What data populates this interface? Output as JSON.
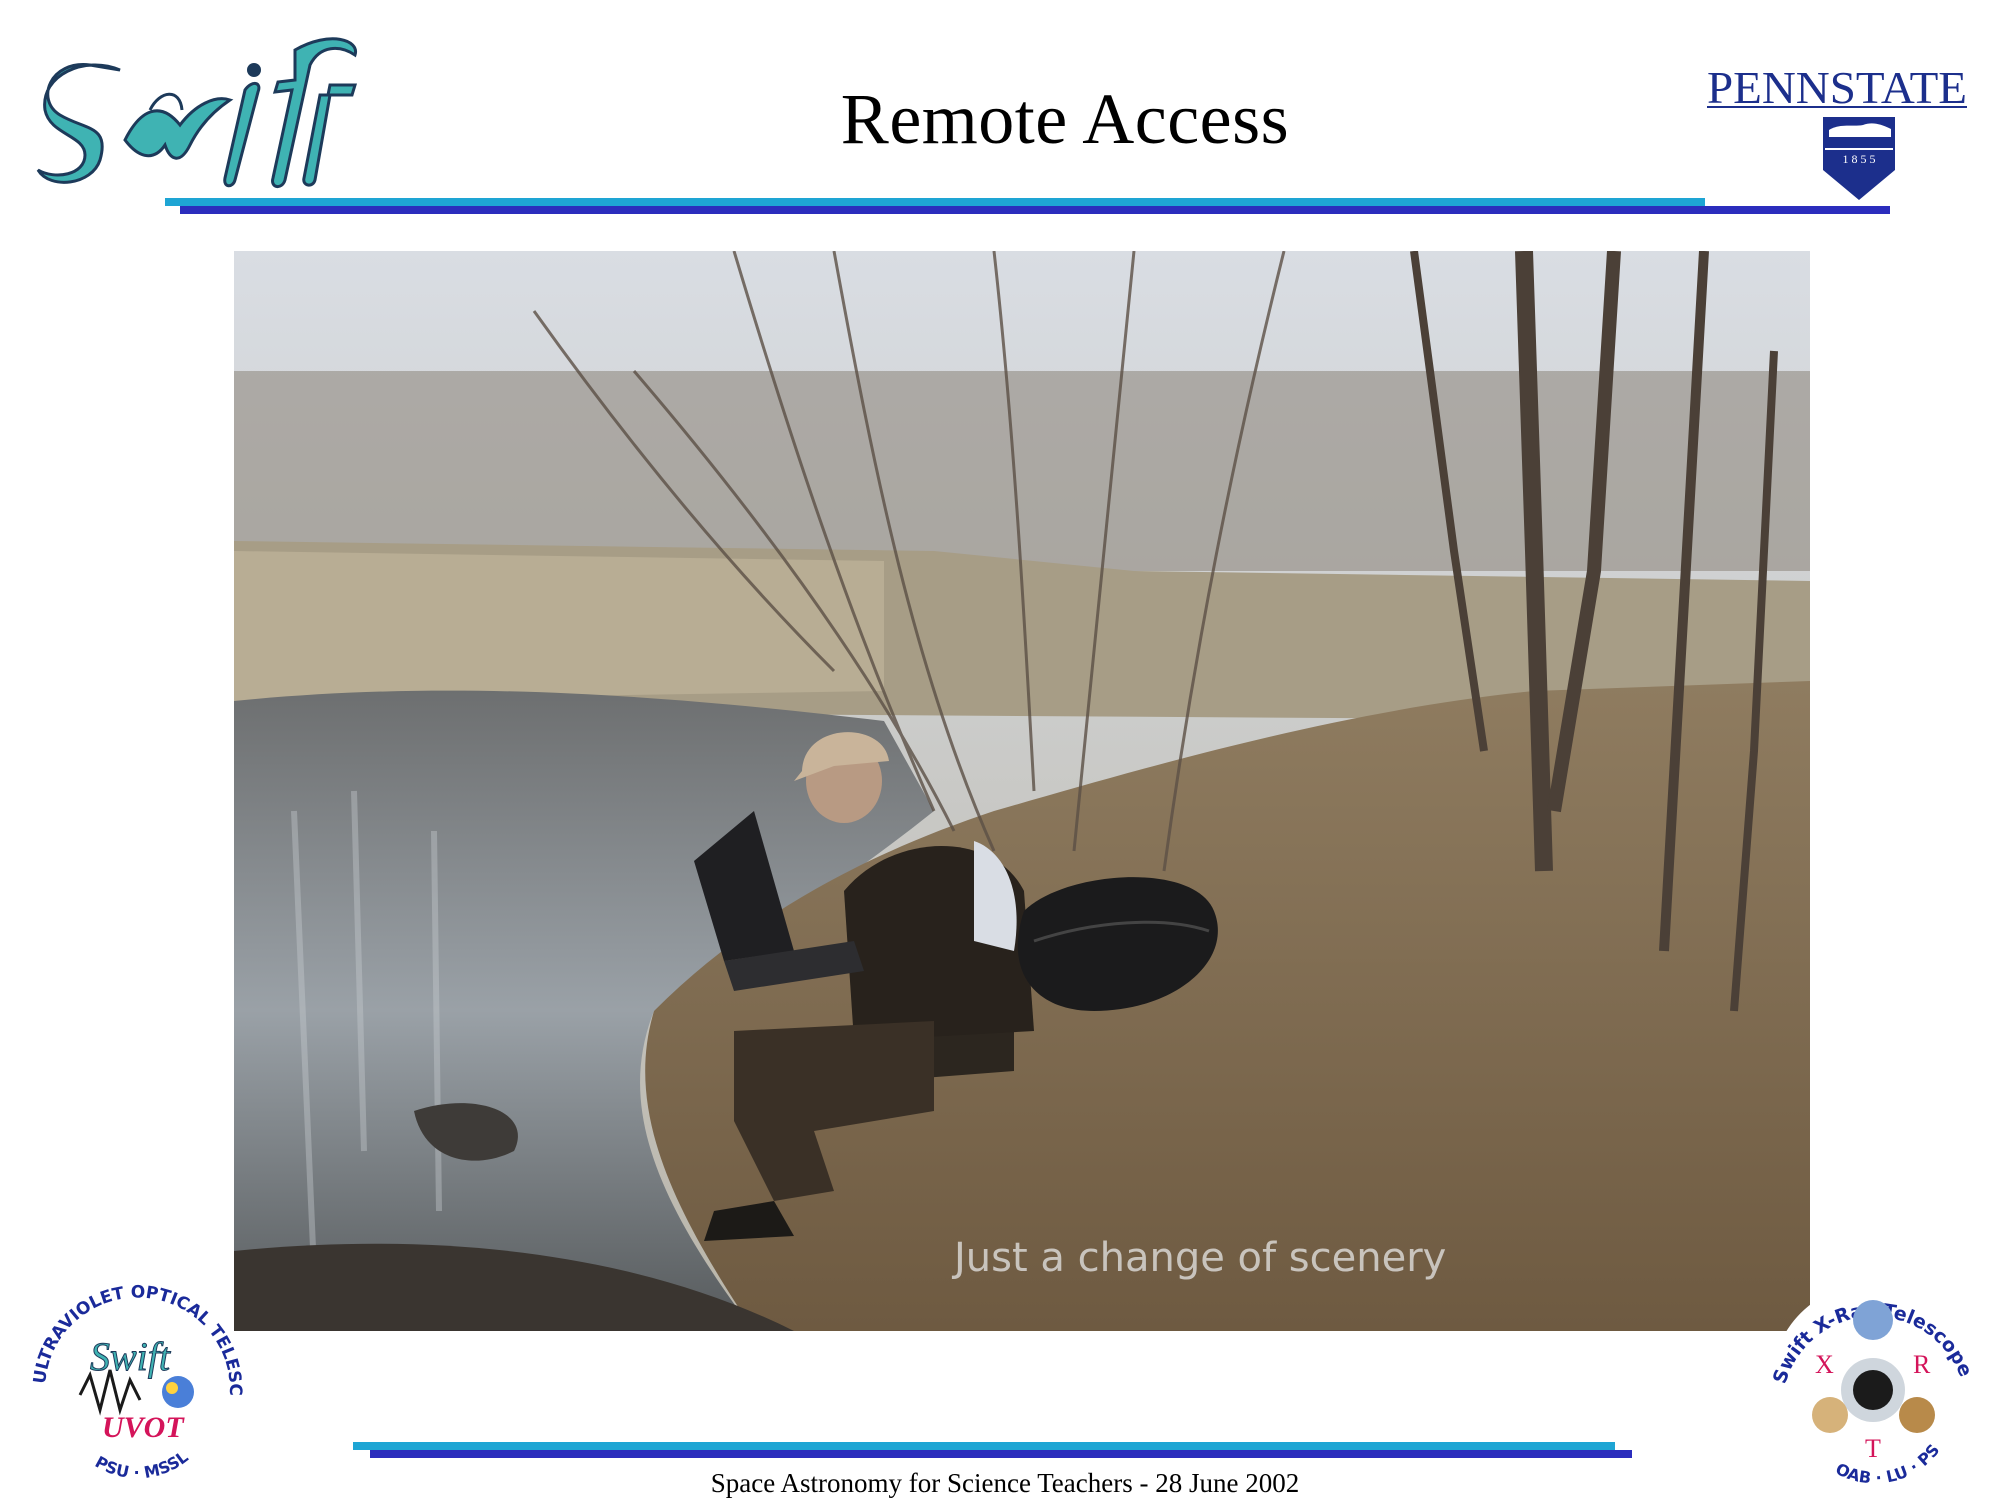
{
  "slide": {
    "title": "Remote Access",
    "footer": "Space Astronomy for Science Teachers -  28 June 2002"
  },
  "logos": {
    "swift": {
      "wordmark": "Swift"
    },
    "pennstate": {
      "wordmark": "PENNSTATE",
      "year": "1 8 5 5"
    },
    "uvot": {
      "ring_text": "ULTRAVIOLET OPTICAL TELESCOPE",
      "bottom_text": "PSU · MSSL",
      "label": "UVOT",
      "wordmark": "Swift"
    },
    "xrt": {
      "ring_text": "Swift X-Ray Telescope",
      "bottom_text": "OAB · LU · PSU",
      "letters": [
        "X",
        "R",
        "T"
      ]
    }
  },
  "photo": {
    "caption": "Just a change of scenery"
  },
  "colors": {
    "bar_cyan": "#1ea5d4",
    "bar_blue": "#2b2dbd",
    "psu_navy": "#1c2f8c",
    "swift_teal": "#39a8a8"
  }
}
